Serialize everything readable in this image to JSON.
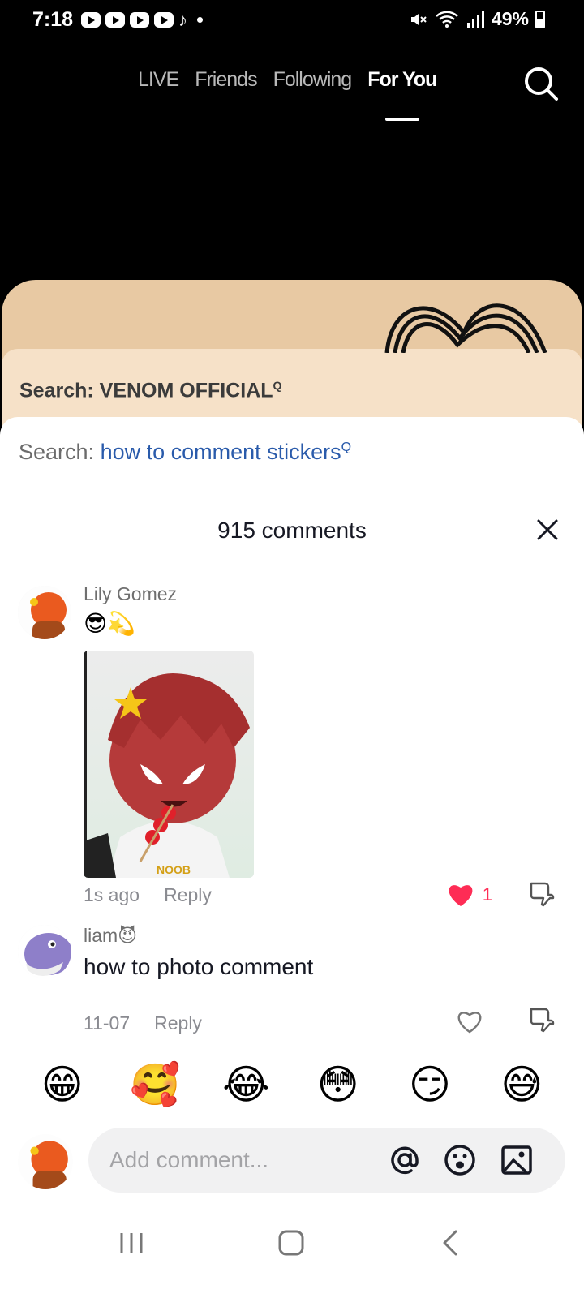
{
  "status_bar": {
    "time": "7:18",
    "battery": "49%",
    "notification_icons": [
      "youtube-icon",
      "youtube-icon",
      "youtube-icon",
      "youtube-icon",
      "tiktok-icon"
    ]
  },
  "top_nav": {
    "tabs": [
      {
        "label": "LIVE"
      },
      {
        "label": "Friends"
      },
      {
        "label": "Following"
      },
      {
        "label": "For You",
        "active": true
      }
    ]
  },
  "video": {
    "overlay_text": "Search: VENOM OFFICIAL"
  },
  "sheet": {
    "search_prefix": "Search:",
    "search_query": "how to comment stickers",
    "comment_count": "915 comments"
  },
  "comments": [
    {
      "username": "Lily Gomez",
      "emojis": "😎💫",
      "sticker_text": "NOOB",
      "time": "1s ago",
      "reply_label": "Reply",
      "likes": "1",
      "liked": true
    },
    {
      "username": "liam😈",
      "text": "how to photo comment",
      "time": "11-07",
      "reply_label": "Reply",
      "liked": false
    }
  ],
  "quick_emojis": [
    "😁",
    "🥰",
    "😂",
    "😳",
    "😏",
    "😅"
  ],
  "composer": {
    "placeholder": "Add comment..."
  },
  "colors": {
    "accent_blue": "#2a5bab",
    "like_red": "#fe2c55",
    "text_dark": "#161823",
    "text_muted": "#8a8b91"
  }
}
